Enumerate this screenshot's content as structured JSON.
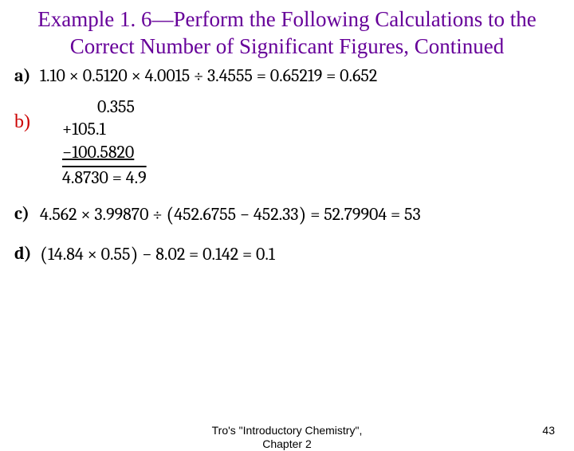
{
  "title": "Example 1. 6—Perform the Following Calculations to the Correct Number of Significant Figures, Continued",
  "items": {
    "a": {
      "label": "a)",
      "expr": "1.10 × 0.5120 × 4.0015 ÷ 3.4555 = 0.65219 = 0.652"
    },
    "b": {
      "label": "b)",
      "lines": [
        "0.355",
        "+105.1",
        "−100.5820"
      ],
      "result": "4.8730 = 4.9"
    },
    "c": {
      "label": "c)",
      "expr_pre": "4.562 × 3.99870 ÷ ",
      "expr_inner": "452.6755 − 452.33",
      "expr_post": " = 52.79904 = 53"
    },
    "d": {
      "label": "d)",
      "expr_inner": "14.84 × 0.55",
      "expr_post": " − 8.02 = 0.142 = 0.1"
    }
  },
  "footer": {
    "center_line1": "Tro's \"Introductory Chemistry\",",
    "center_line2": "Chapter 2",
    "page": "43"
  }
}
